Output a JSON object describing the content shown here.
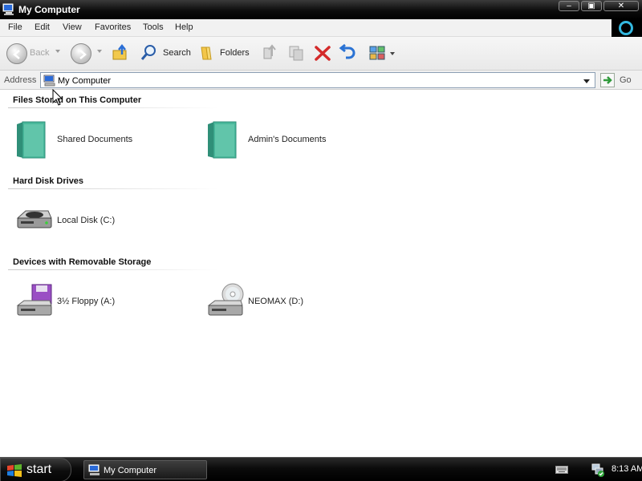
{
  "window": {
    "title": "My Computer"
  },
  "menu": {
    "items": [
      "File",
      "Edit",
      "View",
      "Favorites",
      "Tools",
      "Help"
    ]
  },
  "toolbar": {
    "back_label": "Back",
    "search_label": "Search",
    "folders_label": "Folders"
  },
  "address": {
    "label": "Address",
    "value": "My Computer",
    "go_label": "Go"
  },
  "groups": [
    {
      "title": "Files Stored on This Computer",
      "items": [
        {
          "label": "Shared Documents",
          "icon": "folder-icon"
        },
        {
          "label": "Admin's Documents",
          "icon": "folder-icon"
        }
      ]
    },
    {
      "title": "Hard Disk Drives",
      "items": [
        {
          "label": "Local Disk (C:)",
          "icon": "hard-disk-icon"
        }
      ]
    },
    {
      "title": "Devices with Removable Storage",
      "items": [
        {
          "label": "3½ Floppy (A:)",
          "icon": "floppy-drive-icon"
        },
        {
          "label": "NEOMAX (D:)",
          "icon": "cd-drive-icon"
        }
      ]
    }
  ],
  "taskbar": {
    "start_label": "start",
    "task_label": "My Computer",
    "clock": "8:13 AM"
  },
  "colors": {
    "titlebar": "#0c0c0c",
    "folder": "#3cb39a",
    "accent": "#33b8e0"
  }
}
